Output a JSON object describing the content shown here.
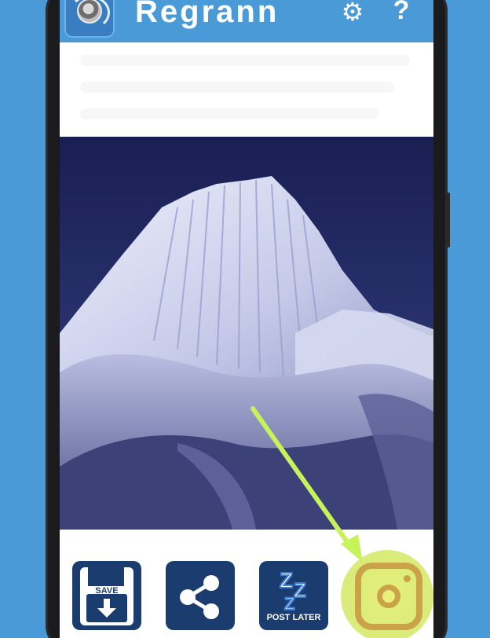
{
  "app": {
    "title": "Regrann",
    "icons": {
      "logo": "regrann-camera-logo",
      "settings": "gear-icon",
      "help": "question-icon"
    },
    "help_glyph": "?"
  },
  "colors": {
    "app_bar": "#4a9ad8",
    "button_bg": "#1a3c6e",
    "instagram_gold": "#c9a24a",
    "highlight_green": "#c6f25a"
  },
  "actions": {
    "save": {
      "label": "SAVE",
      "icon": "floppy-disk-download-icon"
    },
    "share": {
      "icon": "share-icon"
    },
    "post_later": {
      "label": "POST LATER",
      "icon": "zzz-sleep-icon"
    },
    "repost": {
      "icon": "instagram-icon"
    }
  },
  "image": {
    "subject": "snow-covered mountain peak at night"
  }
}
